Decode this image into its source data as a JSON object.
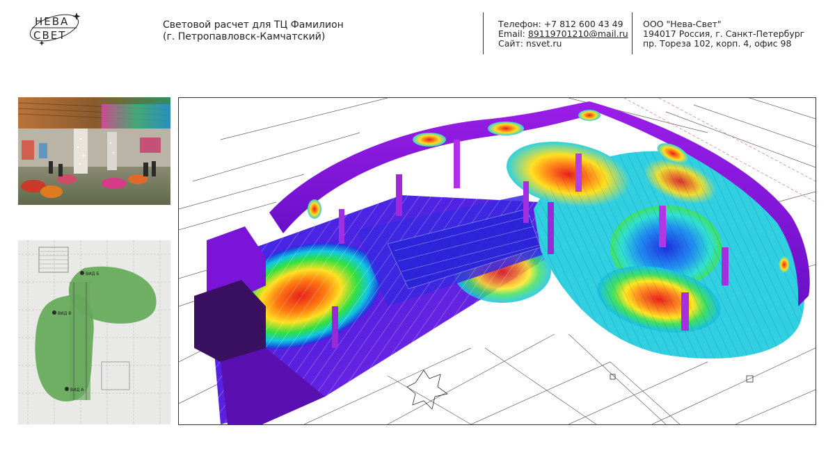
{
  "header": {
    "logo": {
      "top": "НЕВА",
      "bottom": "СВЕТ"
    },
    "title_line1": "Световой расчет для ТЦ Фамилион",
    "title_line2": "(г. Петропавловск-Камчатский)",
    "contacts": {
      "phone": "Телефон: +7 812 600 43 49",
      "email_label": "Email: ",
      "email": "89119701210@mail.ru",
      "site": "Сайт: nsvet.ru"
    },
    "company": {
      "name": "ООО \"Нева-Свет\"",
      "address1": "194017 Россия, г. Санкт-Петербург",
      "address2": "пр. Тореза 102, корп. 4, офис 98"
    }
  },
  "plan": {
    "labels": {
      "b": "ВИД Б",
      "v": "ВИД В",
      "a": "ВИД А"
    }
  },
  "colors": {
    "accent_green": "#62a855",
    "heat_red": "#e8201c",
    "heat_violet": "#8a1ee0",
    "heat_blue": "#1f2fe0"
  }
}
